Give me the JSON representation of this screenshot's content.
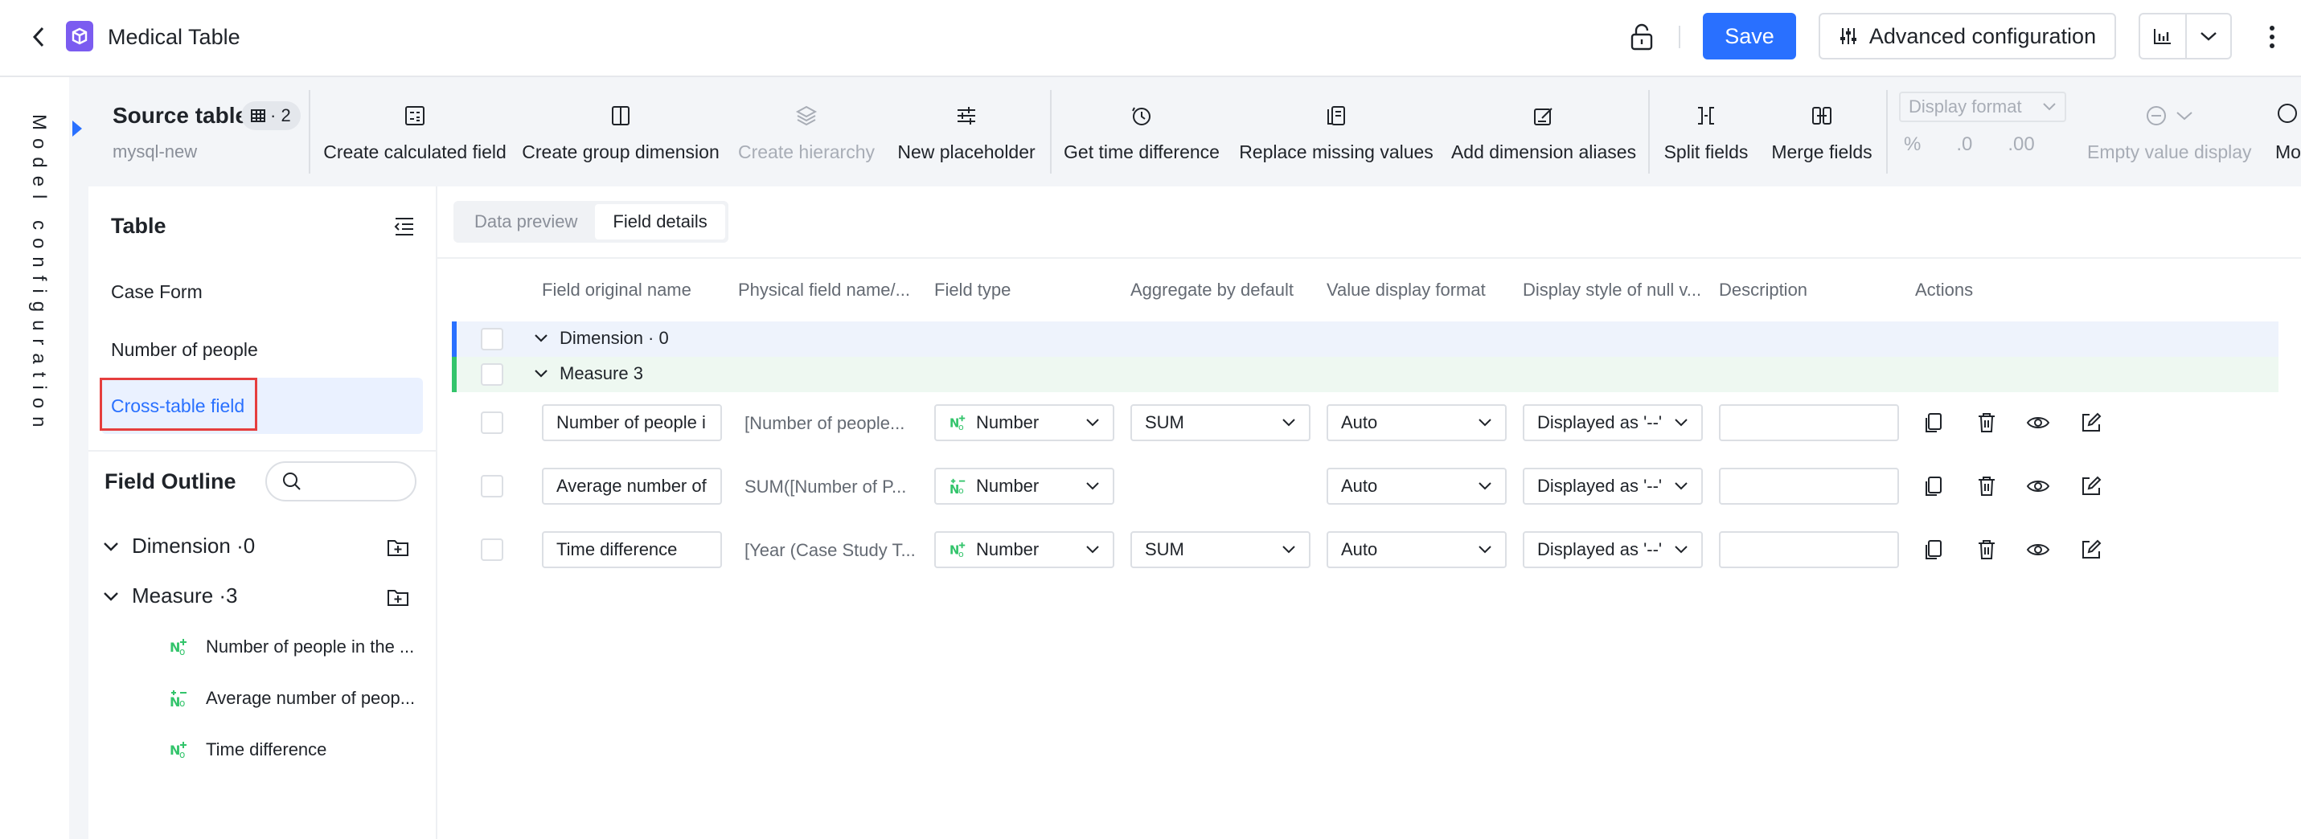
{
  "header": {
    "title": "Medical Table",
    "save_label": "Save",
    "advanced_label": "Advanced configuration"
  },
  "rail": {
    "title": "Model configuration"
  },
  "source": {
    "title": "Source table",
    "count": "· 2",
    "connection": "mysql-new"
  },
  "toolbar": {
    "tools": [
      {
        "label": "Create calculated field",
        "icon": "calculator-icon",
        "disabled": false
      },
      {
        "label": "Create group dimension",
        "icon": "columns-icon",
        "disabled": false
      },
      {
        "label": "Create hierarchy",
        "icon": "layers-icon",
        "disabled": true
      },
      {
        "label": "New placeholder",
        "icon": "sliders-icon",
        "disabled": false
      },
      {
        "label": "Get time difference",
        "icon": "clock-icon",
        "disabled": false
      },
      {
        "label": "Replace missing values",
        "icon": "replace-icon",
        "disabled": false
      },
      {
        "label": "Add dimension aliases",
        "icon": "edit-box-icon",
        "disabled": false
      },
      {
        "label": "Split fields",
        "icon": "split-icon",
        "disabled": false
      },
      {
        "label": "Merge fields",
        "icon": "merge-icon",
        "disabled": false
      }
    ],
    "display_format_placeholder": "Display format",
    "format_percent": "%",
    "format_decrease": ".0",
    "format_increase": ".00",
    "empty_value_label": "Empty value display",
    "more_label": "Mo"
  },
  "left_panel": {
    "table_title": "Table",
    "tables": [
      "Case Form",
      "Number of people",
      "Cross-table field"
    ],
    "active_table": "Cross-table field",
    "outline_title": "Field Outline",
    "dimension_label": "Dimension",
    "dimension_count": "·0",
    "measure_label": "Measure",
    "measure_count": "·3",
    "measures": [
      "Number of people in the ...",
      "Average number of peop...",
      "Time difference"
    ]
  },
  "main": {
    "tabs": [
      "Data preview",
      "Field details"
    ],
    "active_tab": "Field details",
    "columns": [
      "Field original name",
      "Physical field name/...",
      "Field type",
      "Aggregate by default",
      "Value display format",
      "Display style of null v...",
      "Description",
      "Actions"
    ],
    "dimension_group": "Dimension · 0",
    "measure_group": "Measure 3",
    "rows": [
      {
        "name": "Number of people i",
        "physical": "[Number of people...",
        "type": "Number",
        "aggregate": "SUM",
        "format": "Auto",
        "null_style": "Displayed as '--'",
        "description": ""
      },
      {
        "name": "Average number of",
        "physical": "SUM([Number of P...",
        "type": "Number",
        "aggregate": "",
        "format": "Auto",
        "null_style": "Displayed as '--'",
        "description": ""
      },
      {
        "name": "Time difference",
        "physical": "[Year (Case Study T...",
        "type": "Number",
        "aggregate": "SUM",
        "format": "Auto",
        "null_style": "Displayed as '--'",
        "description": ""
      }
    ]
  },
  "colors": {
    "primary": "#2970ff",
    "dimension_bar": "#2970ff",
    "measure_bar": "#33c46b",
    "highlight": "#e53e3e",
    "logo": "#7b5cf0"
  }
}
